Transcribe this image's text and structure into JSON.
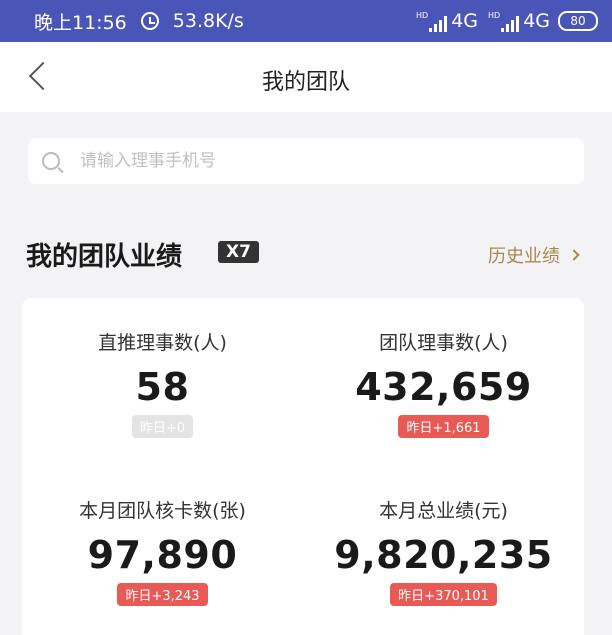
{
  "status_bar": {
    "time": "晚上11:56",
    "speed": "53.8K/s",
    "hd": "HD",
    "network1": "4G",
    "network2": "4G",
    "battery": "80"
  },
  "nav": {
    "title": "我的团队"
  },
  "search": {
    "placeholder": "请输入理事手机号"
  },
  "section": {
    "title": "我的团队业绩",
    "badge": "X7",
    "history_link": "历史业绩"
  },
  "stats": [
    {
      "label": "直推理事数(人)",
      "value": "58",
      "delta": "昨日+0"
    },
    {
      "label": "团队理事数(人)",
      "value": "432,659",
      "delta": "昨日+1,661"
    },
    {
      "label": "本月团队核卡数(张)",
      "value": "97,890",
      "delta": "昨日+3,243"
    },
    {
      "label": "本月总业绩(元)",
      "value": "9,820,235",
      "delta": "昨日+370,101"
    }
  ],
  "colors": {
    "status_bar": "#4a55b8",
    "accent_gold": "#a8884e",
    "delta_red": "#e85a55"
  }
}
